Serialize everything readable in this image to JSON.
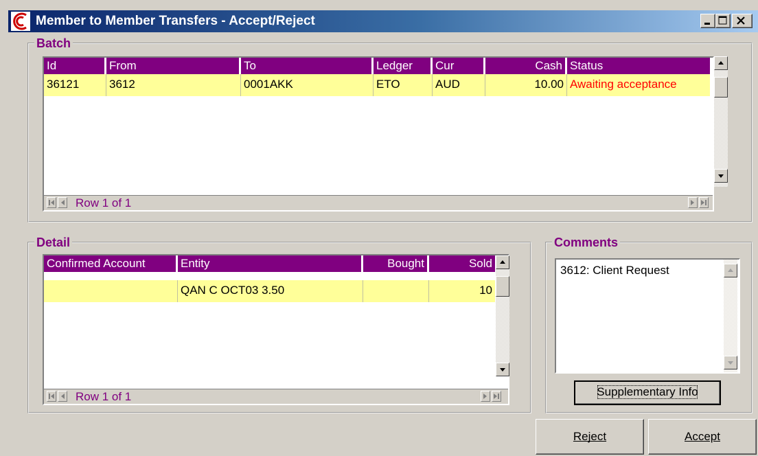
{
  "window": {
    "title": "Member to Member Transfers - Accept/Reject",
    "controls": [
      "minimize",
      "maximize",
      "close"
    ]
  },
  "batch": {
    "legend": "Batch",
    "columns": [
      "Id",
      "From",
      "To",
      "Ledger",
      "Cur",
      "Cash",
      "Status"
    ],
    "rows": [
      {
        "id": "36121",
        "from": "3612",
        "to": "0001AKK",
        "ledger": "ETO",
        "cur": "AUD",
        "cash": "10.00",
        "status": "Awaiting acceptance"
      }
    ],
    "nav_text": "Row 1 of 1"
  },
  "detail": {
    "legend": "Detail",
    "columns": [
      "Confirmed Account",
      "Entity",
      "Bought",
      "Sold"
    ],
    "rows": [
      {
        "confirmed_account": "",
        "entity": "QAN C OCT03 3.50",
        "bought": "",
        "sold": "10"
      }
    ],
    "nav_text": "Row 1 of 1"
  },
  "comments": {
    "legend": "Comments",
    "text": "3612: Client Request",
    "supplementary_button": "Supplementary Info"
  },
  "actions": {
    "reject": "Reject",
    "accept": "Accept"
  },
  "colors": {
    "header_bg": "#800080",
    "row_bg": "#ffff99",
    "status_text": "#ff0000",
    "legend_text": "#800080"
  }
}
